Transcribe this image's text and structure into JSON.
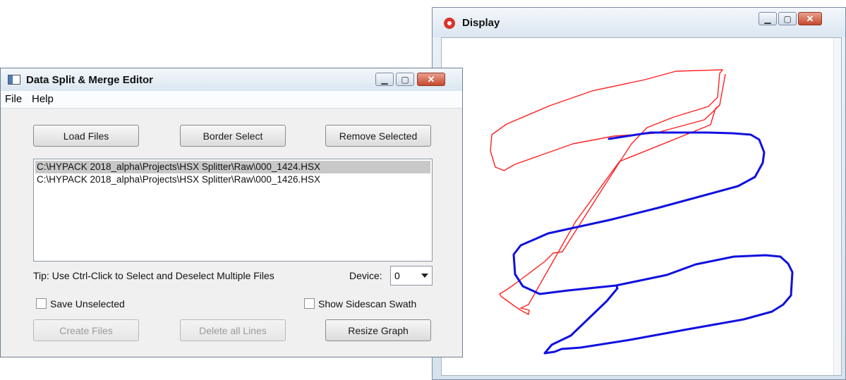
{
  "editor": {
    "title": "Data Split & Merge Editor",
    "menu": [
      "File",
      "Help"
    ],
    "buttons": {
      "load_files": "Load Files",
      "border_select": "Border Select",
      "remove_selected": "Remove Selected",
      "create_files": "Create Files",
      "delete_all_lines": "Delete all Lines",
      "resize_graph": "Resize Graph"
    },
    "files": [
      "C:\\HYPACK 2018_alpha\\Projects\\HSX Splitter\\Raw\\000_1424.HSX",
      "C:\\HYPACK 2018_alpha\\Projects\\HSX Splitter\\Raw\\000_1426.HSX"
    ],
    "tip": "Tip: Use Ctrl-Click to Select and Deselect Multiple Files",
    "device_label": "Device:",
    "device_value": "0",
    "save_unselected": "Save Unselected",
    "show_sidescan": "Show Sidescan Swath"
  },
  "display": {
    "title": "Display",
    "track_colors": {
      "red": "#ff2020",
      "blue": "#1010e0"
    }
  }
}
